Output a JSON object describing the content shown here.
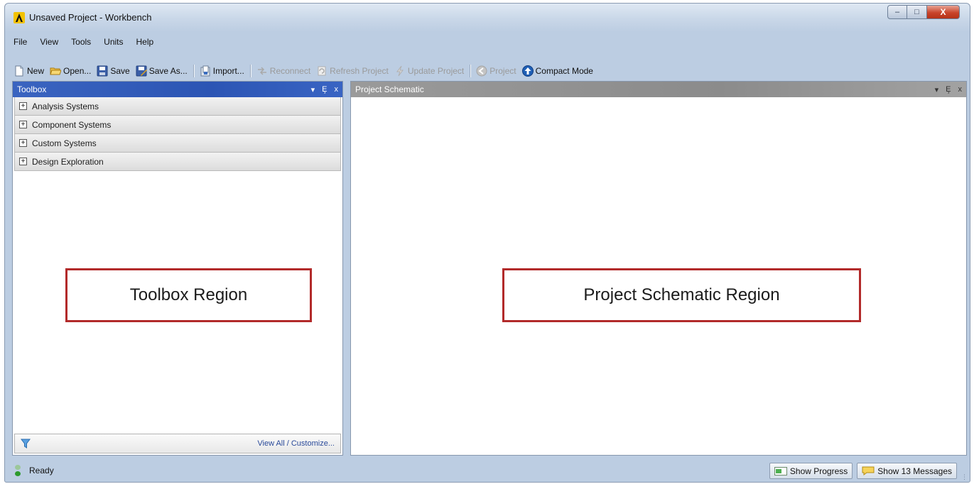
{
  "window": {
    "title": "Unsaved Project - Workbench",
    "controls": {
      "minimize": "–",
      "maximize": "□",
      "close": "X"
    }
  },
  "menu": [
    "File",
    "View",
    "Tools",
    "Units",
    "Help"
  ],
  "toolbar": {
    "new": "New",
    "open": "Open...",
    "save": "Save",
    "save_as": "Save As...",
    "import": "Import...",
    "reconnect": "Reconnect",
    "refresh_project": "Refresh Project",
    "update_project": "Update Project",
    "project": "Project",
    "compact_mode": "Compact Mode"
  },
  "toolbox": {
    "title": "Toolbox",
    "controls": {
      "dropdown": "▾",
      "pin": "Ȩ",
      "close": "x"
    },
    "items": [
      {
        "label": "Analysis Systems",
        "expander": "+"
      },
      {
        "label": "Component Systems",
        "expander": "+"
      },
      {
        "label": "Custom Systems",
        "expander": "+"
      },
      {
        "label": "Design Exploration",
        "expander": "+"
      }
    ],
    "region_label": "Toolbox Region",
    "footer_link": "View All / Customize..."
  },
  "schematic": {
    "title": "Project Schematic",
    "controls": {
      "dropdown": "▾",
      "pin": "Ȩ",
      "close": "x"
    },
    "region_label": "Project Schematic Region"
  },
  "status": {
    "text": "Ready",
    "show_progress": "Show Progress",
    "show_messages": "Show 13 Messages"
  },
  "colors": {
    "toolbox_header": "#2c55b4",
    "schematic_header": "#8b8b8b",
    "callout_border": "#b22a2a",
    "close_button": "#c9442b"
  }
}
